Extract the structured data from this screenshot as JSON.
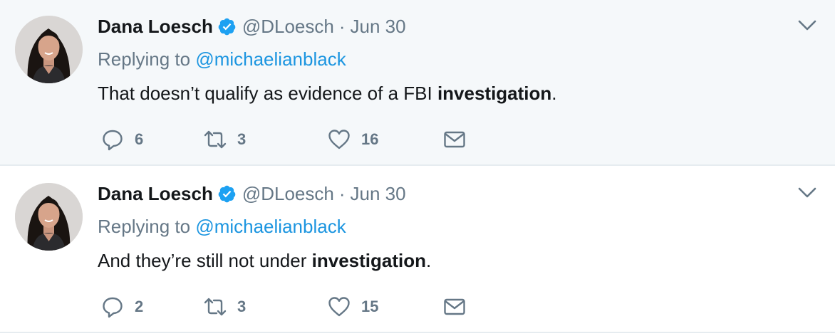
{
  "tweets": [
    {
      "author_name": "Dana Loesch",
      "handle": "@DLoesch",
      "separator": "·",
      "date": "Jun 30",
      "replying_prefix": "Replying to",
      "replying_to": "@michaelianblack",
      "text_before": "That doesn’t qualify as evidence of a FBI ",
      "text_bold": "investigation",
      "text_after": ".",
      "reply_count": "6",
      "retweet_count": "3",
      "like_count": "16"
    },
    {
      "author_name": "Dana Loesch",
      "handle": "@DLoesch",
      "separator": "·",
      "date": "Jun 30",
      "replying_prefix": "Replying to",
      "replying_to": "@michaelianblack",
      "text_before": "And they’re still not under ",
      "text_bold": "investigation",
      "text_after": ".",
      "reply_count": "2",
      "retweet_count": "3",
      "like_count": "15"
    }
  ],
  "icons": {
    "verified": "verified-badge-icon",
    "caret": "chevron-down-icon",
    "reply": "reply-bubble-icon",
    "retweet": "retweet-icon",
    "like": "heart-icon",
    "message": "envelope-icon"
  },
  "colors": {
    "text": "#14171a",
    "secondary": "#657786",
    "link": "#1b95e0",
    "verified": "#1da1f2",
    "highlight_bg": "#f5f8fa",
    "divider": "#e6ecf0"
  }
}
